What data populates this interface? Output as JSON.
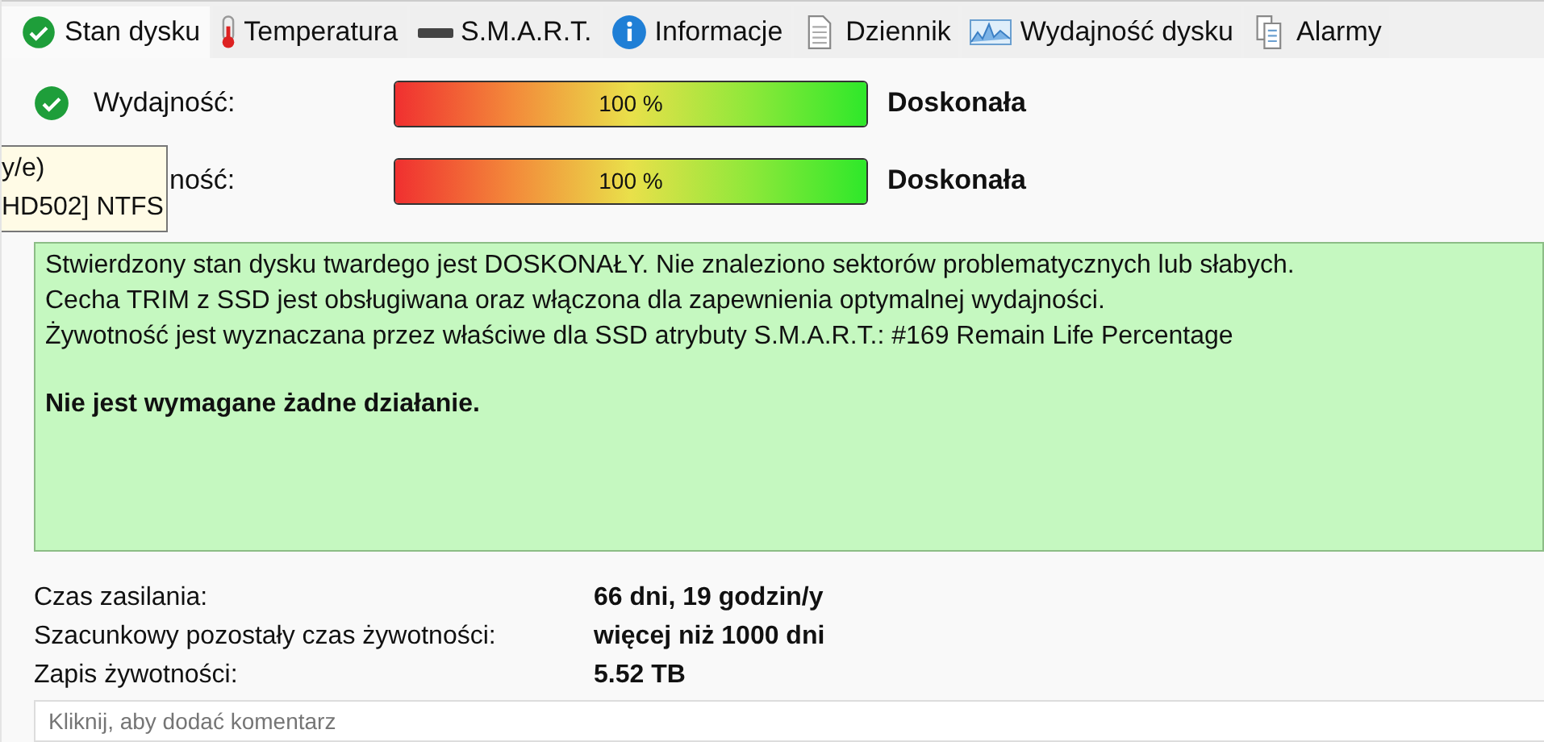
{
  "tabs": [
    {
      "label": "Stan dysku",
      "kind": "check",
      "selected": true
    },
    {
      "label": "Temperatura",
      "kind": "thermometer",
      "selected": false
    },
    {
      "label": "S.M.A.R.T.",
      "kind": "drive",
      "selected": false
    },
    {
      "label": "Informacje",
      "kind": "info",
      "selected": false
    },
    {
      "label": "Dziennik",
      "kind": "document",
      "selected": false
    },
    {
      "label": "Wydajność dysku",
      "kind": "chart",
      "selected": false
    },
    {
      "label": "Alarmy",
      "kind": "documents",
      "selected": false
    }
  ],
  "meters": [
    {
      "label": "Wydajność:",
      "status_ok": true,
      "level": 1,
      "reading": "100 %",
      "rating": "Doskonała"
    },
    {
      "label": "ność:",
      "level": 1,
      "reading": "100 %",
      "rating": "Doskonała"
    }
  ],
  "tooltip": {
    "lines": [
      "y/e)",
      "HD502] NTFS"
    ]
  },
  "message": {
    "lines": [
      "Stwierdzony stan dysku twardego jest DOSKONAŁY. Nie znaleziono sektorów problematycznych lub słabych.",
      "Cecha TRIM z SSD jest obsługiwana oraz włączona dla zapewnienia optymalnej wydajności.",
      "Żywotność jest wyznaczana przez właściwe dla SSD atrybuty S.M.A.R.T.:  #169 Remain Life Percentage"
    ],
    "action": "Nie jest wymagane żadne działanie."
  },
  "info": [
    {
      "label": "Czas zasilania:",
      "value": "66 dni, 19 godzin/y"
    },
    {
      "label": "Szacunkowy pozostały czas żywotności:",
      "value": "więcej niż 1000 dni"
    },
    {
      "label": "Zapis żywotności:",
      "value": "5.52 TB"
    }
  ],
  "comment": {
    "placeholder": "Kliknij, aby dodać komentarz"
  }
}
